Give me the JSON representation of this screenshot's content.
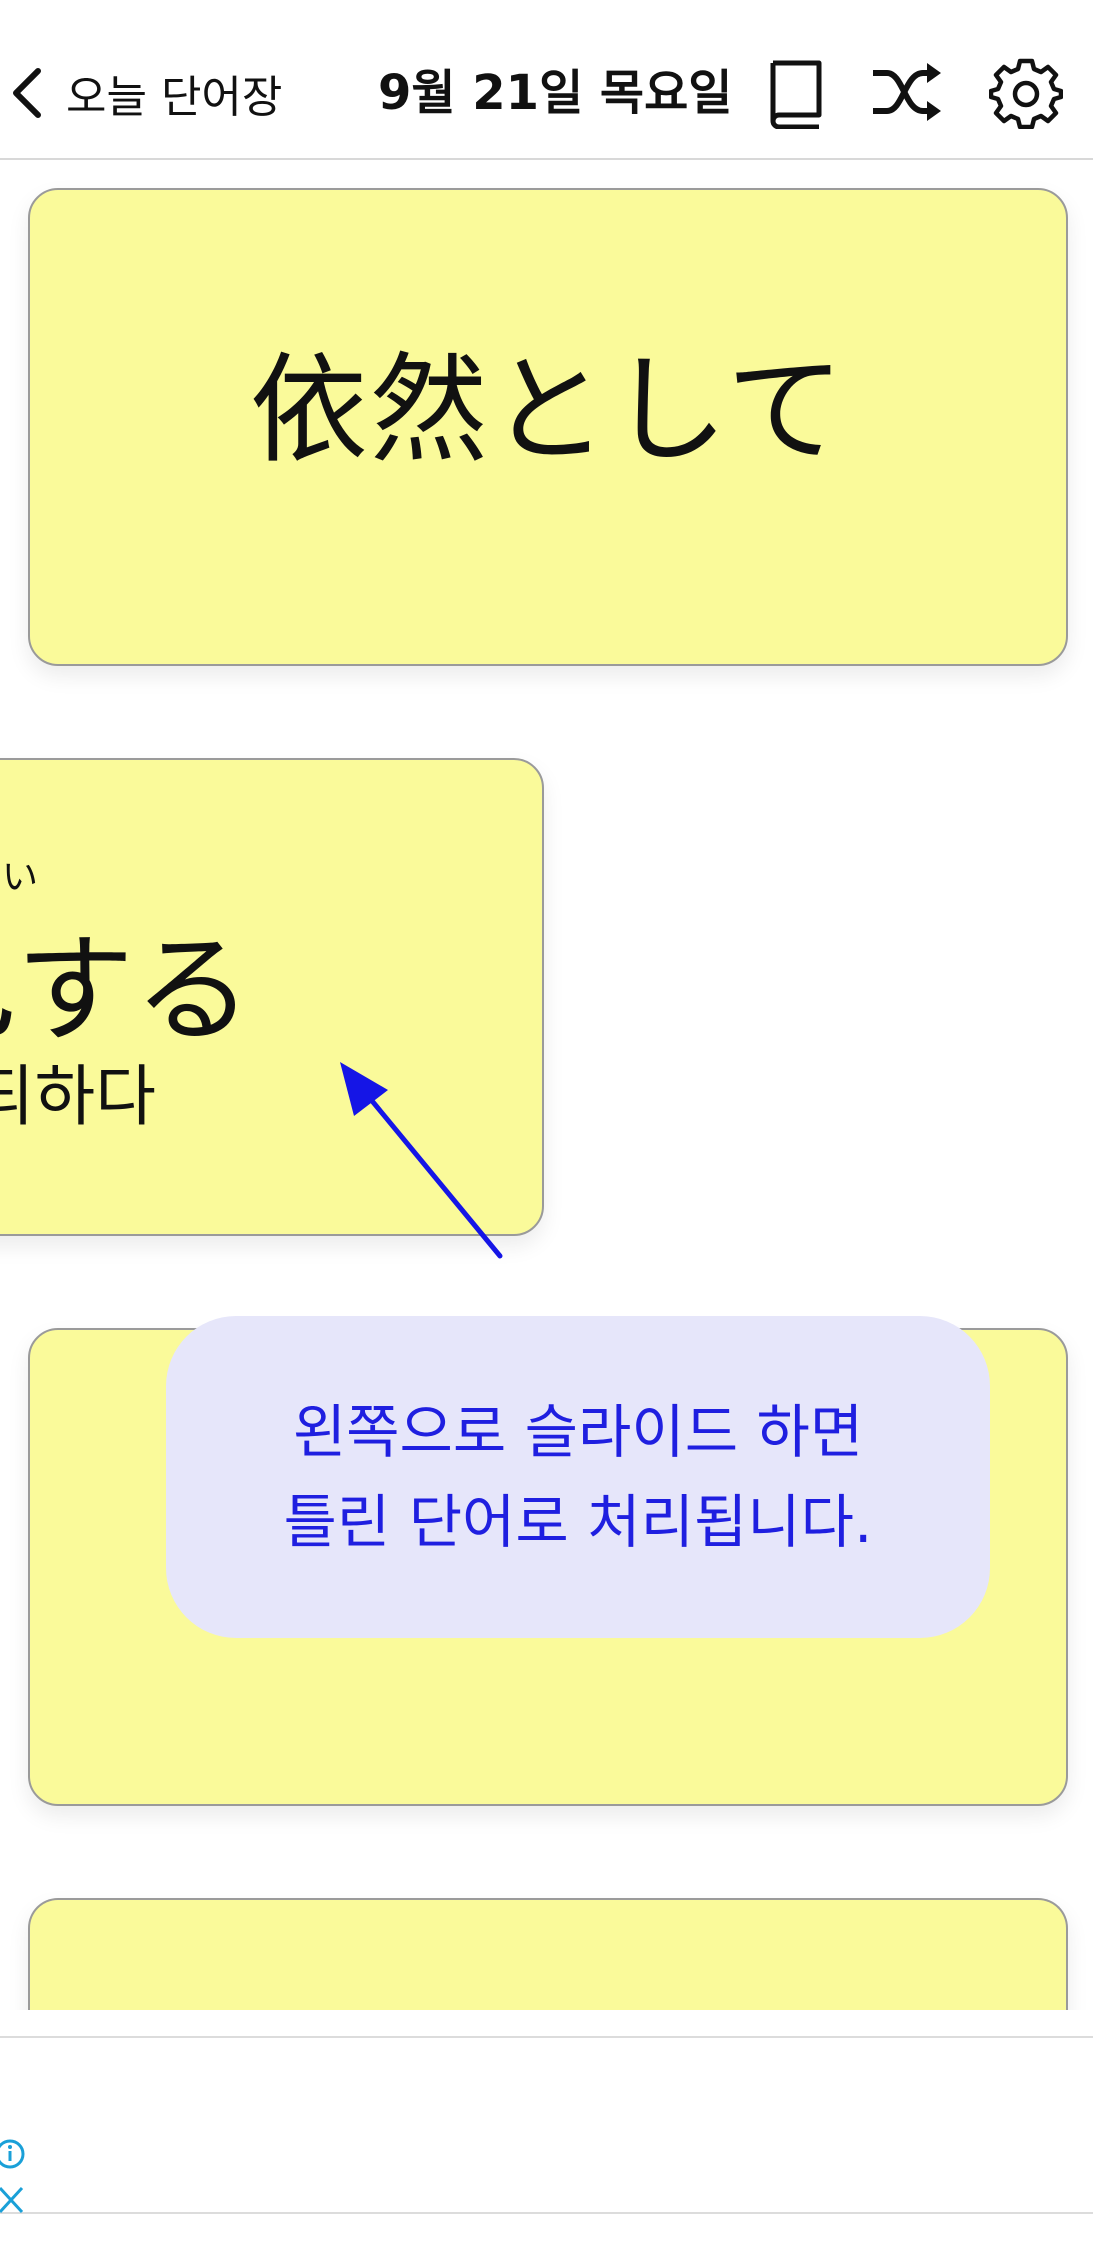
{
  "header": {
    "back_label": "오늘 단어장",
    "date_title": "9월 21일 목요일",
    "icons": [
      "book-icon",
      "shuffle-icon",
      "gear-icon"
    ]
  },
  "cards": [
    {
      "word": "依然として"
    },
    {
      "furigana": "い",
      "word": "する",
      "meaning": "하다"
    },
    {
      "word": ""
    },
    {
      "word": ""
    }
  ],
  "tooltip": {
    "text": "왼쪽으로 슬라이드 하면\n틀린 단어로 처리됩니다."
  },
  "colors": {
    "card_bg": "#fafa9a",
    "tooltip_bg": "#e6e6fa",
    "tooltip_text": "#1f1fe0",
    "arrow": "#1515e6",
    "ad_icon": "#1aa0d8"
  }
}
